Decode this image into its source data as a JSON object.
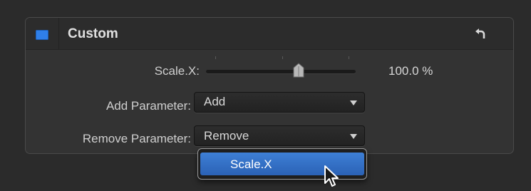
{
  "panel": {
    "title": "Custom",
    "enabled": true,
    "accent_color": "#2f7fe8",
    "reset_icon": "reset-arrow-icon"
  },
  "parameters": {
    "scale_label": "Scale.X:",
    "scale_value": "100.0 %",
    "scale_slider_fraction": 0.62,
    "add_label": "Add Parameter:",
    "add_value": "Add",
    "remove_label": "Remove Parameter:",
    "remove_value": "Remove"
  },
  "remove_menu": {
    "items": [
      {
        "label": "Scale.X",
        "highlighted": true
      }
    ]
  },
  "cursor": "arrow-pointer-icon"
}
